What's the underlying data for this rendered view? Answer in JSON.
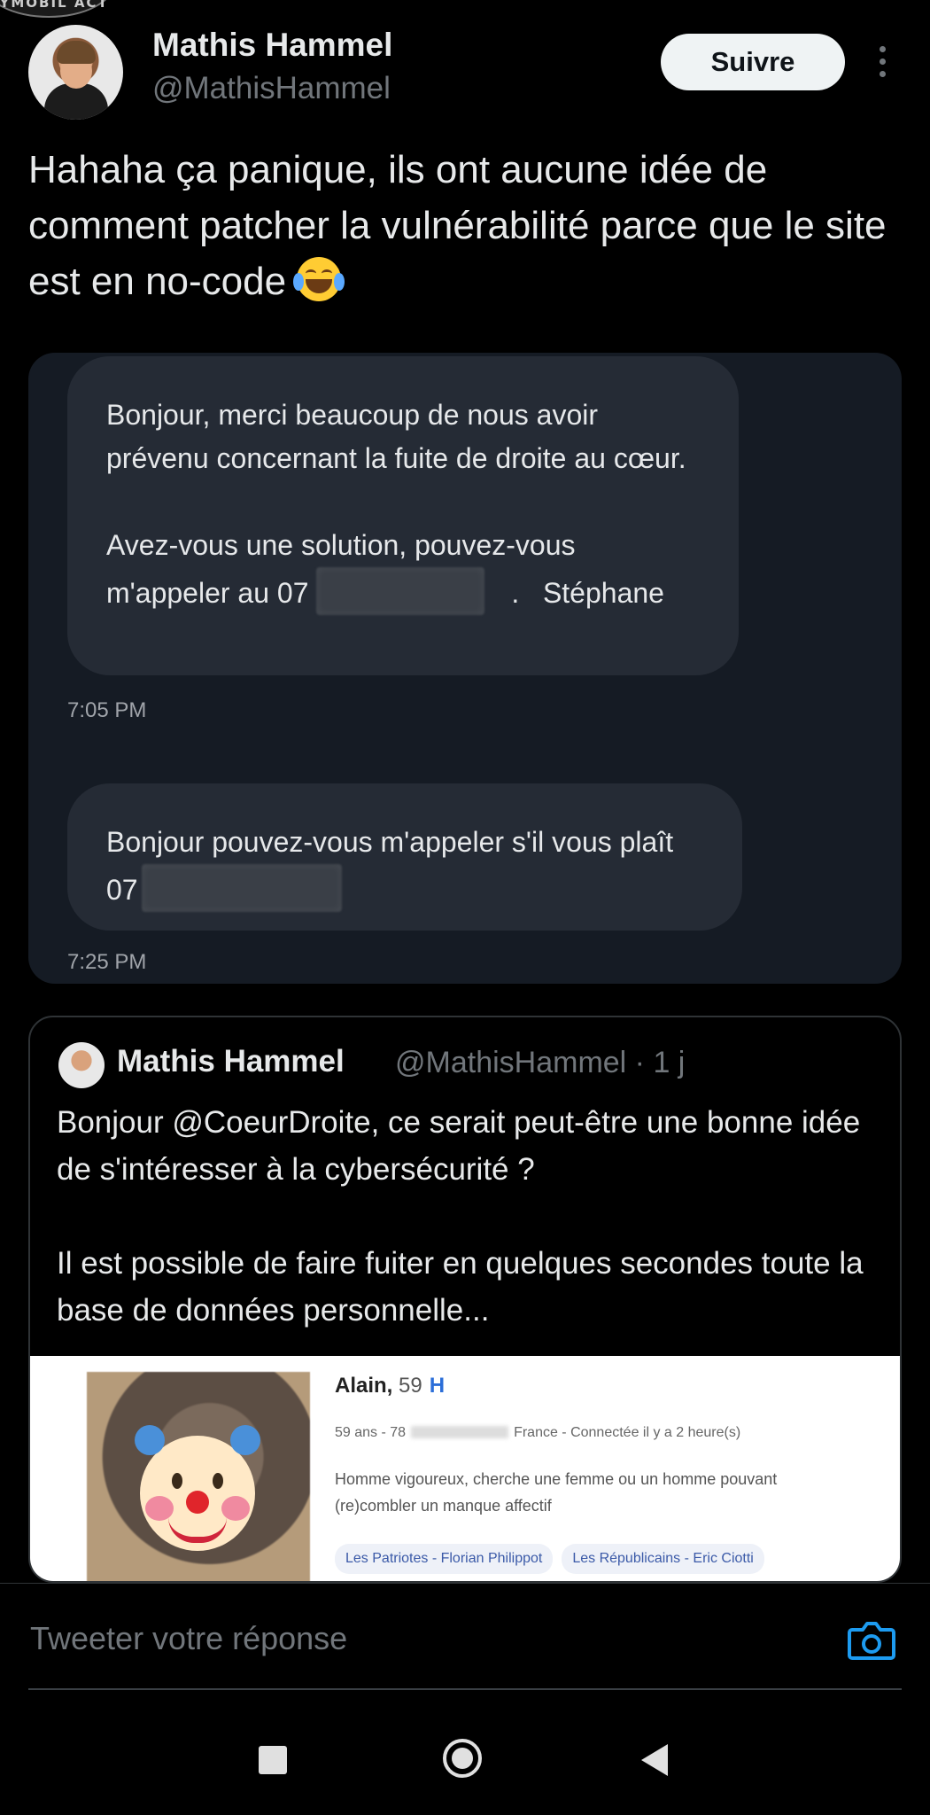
{
  "corner_badge": "AYMOBIL ACT",
  "tweet": {
    "author_name": "Mathis Hammel",
    "author_handle": "@MathisHammel",
    "follow_label": "Suivre",
    "text_before_emoji": "Hahaha ça panique, ils ont aucune idée de comment patcher la vulnérabilité parce que le site est en no-code ",
    "emoji": "face-with-tears-of-joy"
  },
  "chat": {
    "message1_part1": "Bonjour, merci beaucoup de nous avoir prévenu concernant la fuite de droite au cœur.\n\nAvez-vous une solution, pouvez-vous m'appeler au 07 ",
    "message1_part2": ".   Stéphane",
    "time1": "7:05 PM",
    "message2": "Bonjour pouvez-vous m'appeler s'il vous plaît  07",
    "time2": "7:25 PM"
  },
  "quote": {
    "author_name": "Mathis Hammel",
    "meta": "@MathisHammel · 1 j",
    "text": "Bonjour @CoeurDroite, ce serait peut-être une bonne idée de s'intéresser à la cybersécurité ?\n\nIl est possible de faire fuiter en quelques secondes toute la base de données personnelle...",
    "profile": {
      "name": "Alain,",
      "age": "59",
      "gender": "H",
      "meta_prefix": "59 ans - 78",
      "meta_suffix": "France - Connectée il y a 2 heure(s)",
      "bio": "Homme vigoureux, cherche une femme ou un homme pouvant (re)combler un manque affectif",
      "tags": [
        "Les Patriotes - Florian Philippot",
        "Les Républicains - Eric Ciotti"
      ]
    }
  },
  "reply": {
    "placeholder": "Tweeter votre réponse",
    "camera_icon": "camera-icon"
  },
  "navbar": {
    "recents_icon": "square-icon",
    "home_icon": "home-circle-icon",
    "back_icon": "back-triangle-icon"
  },
  "colors": {
    "background": "#000000",
    "follow_button": "#eff3f4",
    "secondary_text": "#71767b",
    "accent_blue": "#1d9bf0",
    "chat_bg": "#151b24",
    "bubble_bg": "#252b35"
  }
}
